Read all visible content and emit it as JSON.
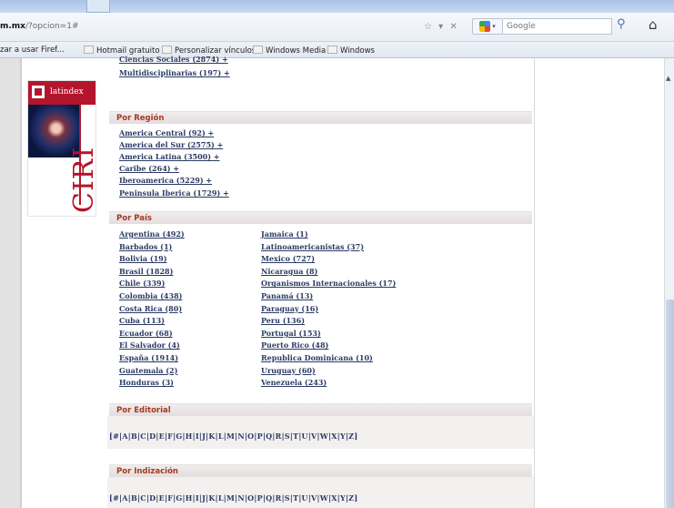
{
  "browser": {
    "url_host": "m.mx",
    "url_path": "/?opcion=1#",
    "url_controls": "☆ ▾ ✕",
    "search_placeholder": "Google",
    "bookmarks": [
      {
        "label": "zar a usar Firef..."
      },
      {
        "label": "Hotmail gratuito"
      },
      {
        "label": "Personalizar vínculos"
      },
      {
        "label": "Windows Media"
      },
      {
        "label": "Windows"
      }
    ]
  },
  "logo": {
    "brand": "latindex",
    "wordmark": "CIRI"
  },
  "areas": {
    "partial_top": "Ciencias Sociales (2874) +",
    "multi": "Multidisciplinarias (197) +"
  },
  "region": {
    "title": "Por Región",
    "items": [
      "America Central (92) +",
      "America del Sur (2575) +",
      "America Latina (3500) +",
      "Caribe (264) +",
      "Iberoamerica (5229) +",
      "Peninsula Iberica (1729) +"
    ]
  },
  "pais": {
    "title": "Por País",
    "col1": [
      "Argentina (492)",
      "Barbados (1)",
      "Bolivia (19)",
      "Brasil (1828)",
      "Chile (339)",
      "Colombia (438)",
      "Costa Rica (80)",
      "Cuba (113)",
      "Ecuador (68)",
      "El Salvador (4)",
      "España (1914)",
      "Guatemala (2)",
      "Honduras (3)"
    ],
    "col2": [
      "Jamaica (1)",
      "Latinoamericanistas (37)",
      "Mexico (727)",
      "Nicaragua (8)",
      "Organismos Internacionales (17)",
      "Panamá (13)",
      "Paraguay (16)",
      "Peru (136)",
      "Portugal (153)",
      "Puerto Rico (48)",
      "Republica Dominicana (10)",
      "Uruguay (60)",
      "Venezuela (243)"
    ]
  },
  "editorial": {
    "title": "Por Editorial",
    "alphabet": "[#|A|B|C|D|E|F|G|H|I|J|K|L|M|N|O|P|Q|R|S|T|U|V|W|X|Y|Z]"
  },
  "indizacion": {
    "title": "Por Indización",
    "alphabet": "[#|A|B|C|D|E|F|G|H|I|J|K|L|M|N|O|P|Q|R|S|T|U|V|W|X|Y|Z]"
  }
}
